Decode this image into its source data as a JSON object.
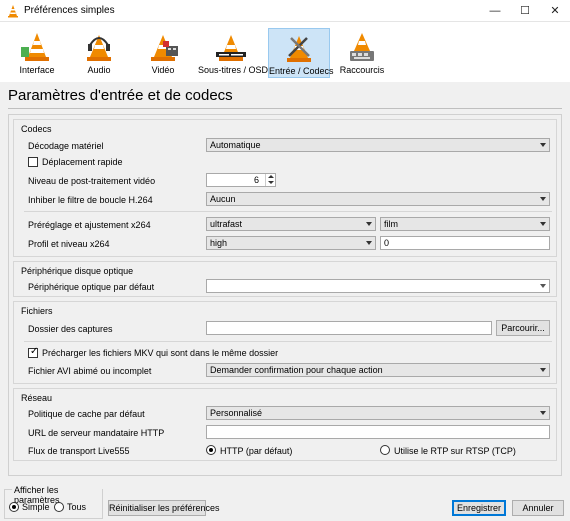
{
  "window": {
    "title": "Préférences simples",
    "minimize": "—",
    "maximize": "☐",
    "close": "✕"
  },
  "toolbar": {
    "items": [
      {
        "label": "Interface",
        "icon": "vlc-cone-icon"
      },
      {
        "label": "Audio",
        "icon": "vlc-cone-headphones-icon"
      },
      {
        "label": "Vidéo",
        "icon": "vlc-cone-film-icon"
      },
      {
        "label": "Sous-titres / OSD",
        "icon": "vlc-cone-subtitles-icon"
      },
      {
        "label": "Entrée / Codecs",
        "icon": "vlc-cone-tools-icon",
        "active": true
      },
      {
        "label": "Raccourcis",
        "icon": "vlc-cone-hotkeys-icon"
      }
    ]
  },
  "page_title": "Paramètres d'entrée et de codecs",
  "codecs": {
    "title": "Codecs",
    "hw_decoding_label": "Décodage matériel",
    "hw_decoding_value": "Automatique",
    "fast_seek_label": "Déplacement rapide",
    "postproc_label": "Niveau de post-traitement vidéo",
    "postproc_value": "6",
    "loopfilter_label": "Inhiber le filtre de boucle H.264",
    "loopfilter_value": "Aucun",
    "x264_preset_label": "Préréglage et ajustement x264",
    "x264_preset_value": "ultrafast",
    "x264_tune_value": "film",
    "x264_profile_label": "Profil et niveau x264",
    "x264_profile_value": "high",
    "x264_level_value": "0"
  },
  "optical": {
    "title": "Périphérique disque optique",
    "device_label": "Périphérique optique par défaut",
    "device_value": ""
  },
  "files": {
    "title": "Fichiers",
    "captures_label": "Dossier des captures",
    "captures_value": "",
    "browse_label": "Parcourir...",
    "preload_mkv_label": "Précharger les fichiers MKV qui sont dans le même dossier",
    "avi_label": "Fichier AVI abimé ou incomplet",
    "avi_value": "Demander confirmation pour chaque action"
  },
  "network": {
    "title": "Réseau",
    "cache_label": "Politique de cache par défaut",
    "cache_value": "Personnalisé",
    "proxy_label": "URL de serveur mandataire HTTP",
    "proxy_value": "",
    "live555_label": "Flux de transport Live555",
    "live555_http": "HTTP (par défaut)",
    "live555_rtp": "Utilise le RTP sur RTSP (TCP)"
  },
  "footer": {
    "show_settings_label": "Afficher les paramètres",
    "simple_label": "Simple",
    "all_label": "Tous",
    "reset_label": "Réinitialiser les préférences",
    "save_label": "Enregistrer",
    "cancel_label": "Annuler"
  },
  "colors": {
    "cone_orange": "#f08a00",
    "active_tab": "#cde4f7",
    "accent": "#0078d7"
  }
}
